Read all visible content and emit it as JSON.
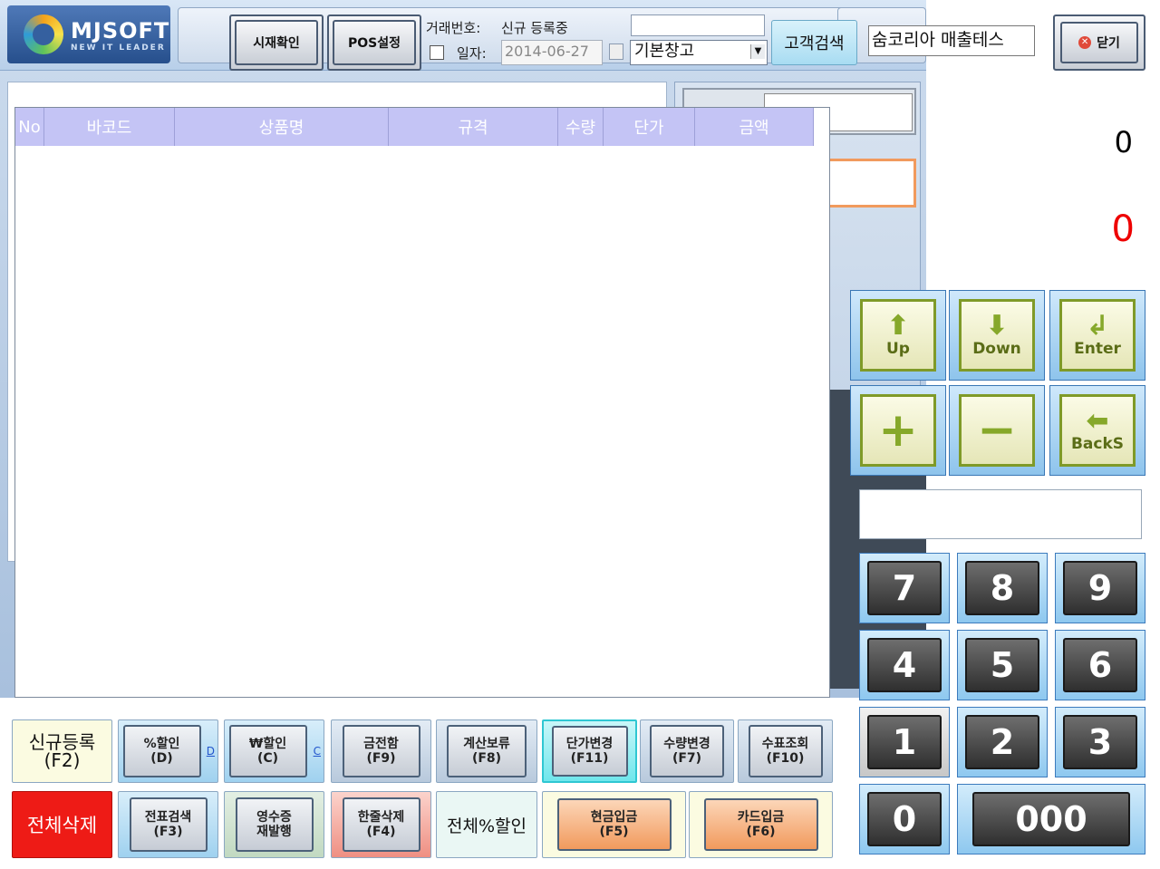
{
  "app": {
    "logo_text": "MJSOFT",
    "logo_sub": "NEW IT LEADER"
  },
  "toolbar": {
    "price_check": "시재확인",
    "pos_settings": "POS설정",
    "trade_no_label": "거래번호:",
    "trade_no_value": "신규 등록중",
    "date_label": "일자:",
    "date_value": "2014-06-27",
    "warehouse": "기본창고",
    "customer_search": "고객검색",
    "customer_name": "숨코리아 매출테스",
    "close": "닫기"
  },
  "grid": {
    "columns": [
      "No",
      "바코드",
      "상품명",
      "규격",
      "수량",
      "단가",
      "금액"
    ],
    "rows": []
  },
  "totals": {
    "amount": "0",
    "balance": "0"
  },
  "nav": {
    "up": "Up",
    "down": "Down",
    "enter": "Enter",
    "backspace": "BackS"
  },
  "keypad": {
    "k7": "7",
    "k8": "8",
    "k9": "9",
    "k4": "4",
    "k5": "5",
    "k6": "6",
    "k1": "1",
    "k2": "2",
    "k3": "3",
    "k0": "0",
    "k000": "000"
  },
  "functions": {
    "new_l1": "신규등록",
    "new_l2": "(F2)",
    "pct_l1": "%할인",
    "pct_l2": "(D)",
    "pct_key": "D",
    "won_l1": "₩할인",
    "won_l2": "(C)",
    "won_key": "C",
    "drawer_l1": "금전함",
    "drawer_l2": "(F9)",
    "hold_l1": "계산보류",
    "hold_l2": "(F8)",
    "price_l1": "단가변경",
    "price_l2": "(F11)",
    "qty_l1": "수량변경",
    "qty_l2": "(F7)",
    "check_l1": "수표조회",
    "check_l2": "(F10)",
    "delete_all": "전체삭제",
    "slip_l1": "전표검색",
    "slip_l2": "(F3)",
    "receipt_l1": "영수증",
    "receipt_l2": "재발행",
    "line_l1": "한줄삭제",
    "line_l2": "(F4)",
    "all_pct": "전체%할인",
    "cash_l1": "현금입금",
    "cash_l2": "(F5)",
    "card_l1": "카드입금",
    "card_l2": "(F6)"
  },
  "colors": {
    "header": "#c4c4f5",
    "accent_orange": "#f19a5d",
    "delete_red": "#ee1b16",
    "total_red": "#ee0000"
  }
}
